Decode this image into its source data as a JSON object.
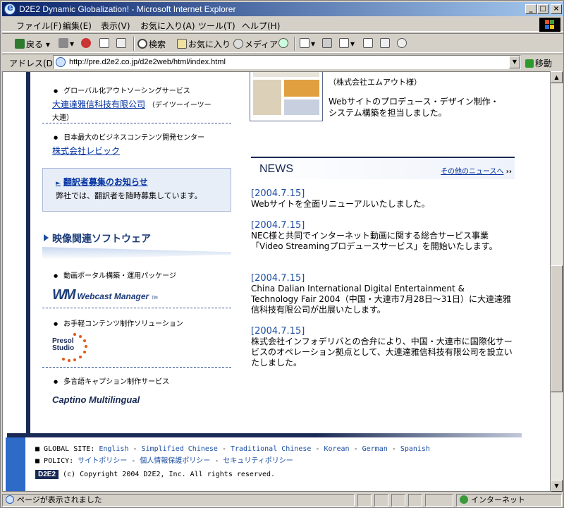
{
  "window": {
    "title": "D2E2 Dynamic Globalization! - Microsoft Internet Explorer",
    "min_glyph": "_",
    "max_glyph": "□",
    "close_glyph": "×"
  },
  "menu": [
    "ファイル(F)",
    "編集(E)",
    "表示(V)",
    "お気に入り(A)",
    "ツール(T)",
    "ヘルプ(H)"
  ],
  "toolbar": {
    "back": "戻る",
    "search": "検索",
    "favorites": "お気に入り",
    "media": "メディア"
  },
  "address": {
    "label": "アドレス(D)",
    "url": "http://pre.d2e2.co.jp/d2e2web/html/index.html",
    "go": "移動"
  },
  "left": {
    "item1_desc": "グローバル化アウトソーシングサービス",
    "item1_link": "大連達雅信科技有限公司",
    "item1_note": "（デイツーイーツー",
    "item1_note2": "大連）",
    "item2_desc": "日本最大のビジネスコンテンツ開発センター",
    "item2_link": "株式会社レビック",
    "notice_head": "翻訳者募集のお知らせ",
    "notice_body": "弊社では、翻訳者を随時募集しています。",
    "section_title": "映像関連ソフトウェア",
    "sw1_desc": "動画ポータル構築・運用パッケージ",
    "sw1_logo": "Webcast Manager",
    "sw1_tm": "TM",
    "sw2_desc": "お手軽コンテンツ制作ソリューション",
    "sw2_logo_line1": "Presol",
    "sw2_logo_line2": "Studio",
    "sw3_desc": "多言語キャプション制作サービス",
    "sw3_logo": "Captino Multilingual"
  },
  "right": {
    "client": "（株式会社エムアウト様）",
    "client_desc": "Webサイトのプロデュース・デザイン制作・システム構築を担当しました。",
    "news_title": "NEWS",
    "news_more": "その他のニュースへ",
    "news": [
      {
        "date": "[2004.7.15]",
        "text": "Webサイトを全面リニューアルいたしました。"
      },
      {
        "date": "[2004.7.15]",
        "text": "NEC様と共同でインターネット動画に関する総合サービス事業「Video Streamingプロデュースサービス」を開始いたします。"
      },
      {
        "date": "[2004.7.15]",
        "text": "China Dalian International Digital Entertainment & Technology Fair 2004（中国・大連市7月28日～31日）に大連達雅信科技有限公司が出展いたします。"
      },
      {
        "date": "[2004.7.15]",
        "text": "株式会社インフォデリバとの合弁により、中国・大連市に国際化サービスのオペレーション拠点として、大連達雅信科技有限公司を設立いたしました。"
      }
    ]
  },
  "footer": {
    "global_label": "GLOBAL SITE:",
    "sites": [
      "English",
      "Simplified Chinese",
      "Traditional Chinese",
      "Korean",
      "German",
      "Spanish"
    ],
    "policy_label": "POLICY:",
    "policies": [
      "サイトポリシー",
      "個人情報保護ポリシー",
      "セキュリティポリシー"
    ],
    "logo": "D2E2",
    "copyright": "(c) Copyright 2004 D2E2, Inc. All rights reserved."
  },
  "status": {
    "text": "ページが表示されました",
    "zone": "インターネット"
  },
  "colors": {
    "title_start": "#0a246a",
    "navy": "#1a2a55",
    "link": "#0030a0",
    "accent_blue": "#2e6ac8"
  }
}
